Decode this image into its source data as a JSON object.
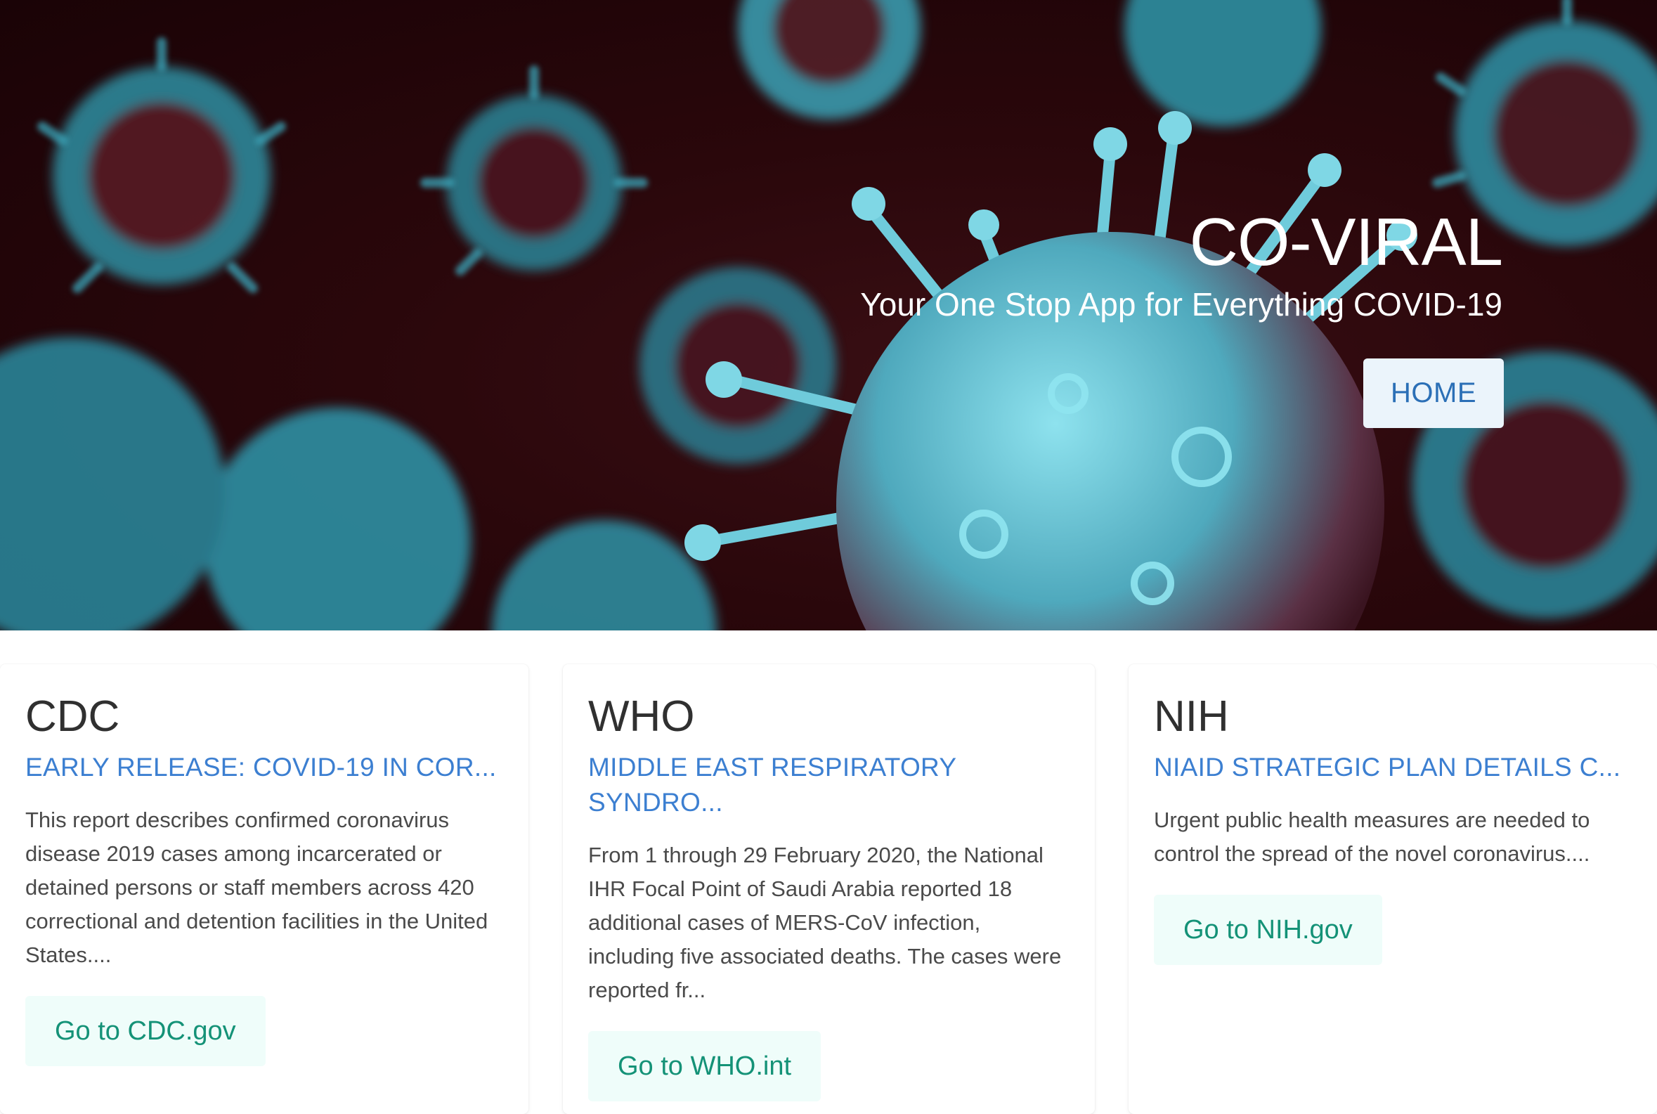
{
  "hero": {
    "title": "CO-VIRAL",
    "subtitle": "Your One Stop App for Everything COVID-19",
    "home_label": "HOME"
  },
  "cards": [
    {
      "title": "CDC",
      "headline": "EARLY RELEASE: COVID-19 IN COR...",
      "body": "This report describes confirmed coronavirus disease 2019 cases among incarcerated or detained persons or staff members across 420 correctional and detention facilities in the United States....",
      "button_label": "Go to CDC.gov"
    },
    {
      "title": "WHO",
      "headline": "MIDDLE EAST RESPIRATORY SYNDRO...",
      "body": "From 1 through 29 February 2020, the National IHR Focal Point of Saudi Arabia reported 18 additional cases of MERS-CoV infection, including five associated deaths. The cases were reported fr...",
      "button_label": "Go to WHO.int"
    },
    {
      "title": "NIH",
      "headline": "NIAID STRATEGIC PLAN DETAILS C...",
      "body": "Urgent public health measures are needed to control the spread of the novel coronavirus....",
      "button_label": "Go to NIH.gov"
    }
  ],
  "colors": {
    "hero_bg": "#2a070b",
    "virus": "#5fd0e0",
    "link": "#3c7fd1",
    "button_text": "#149277",
    "button_bg": "#effdfa",
    "home_bg": "#ebf4fb",
    "home_text": "#2b6fb6"
  }
}
